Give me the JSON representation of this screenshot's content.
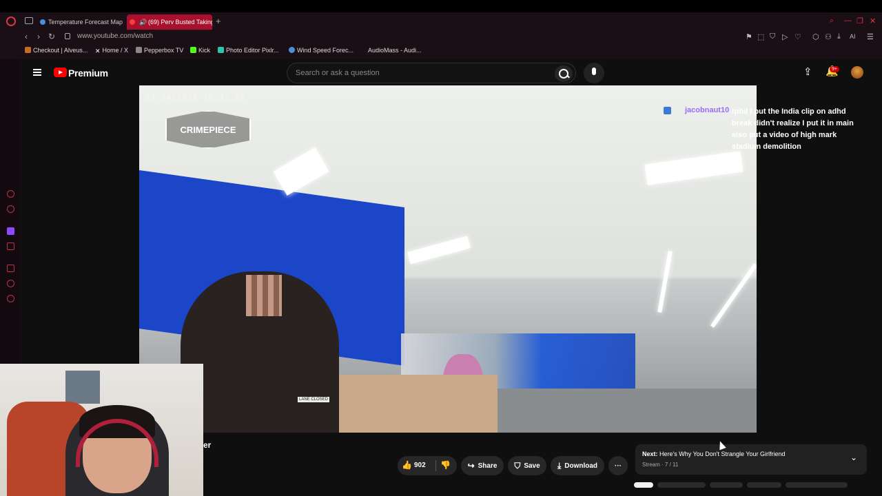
{
  "browser": {
    "tabs": [
      {
        "label": "Temperature Forecast Map",
        "active": false
      },
      {
        "label": "(69) Perv Busted Taking",
        "active": true
      }
    ],
    "new_tab": "+",
    "url": "www.youtube.com/watch",
    "bookmarks": [
      {
        "label": "Checkout | Alveus...",
        "color": "#c46b2a"
      },
      {
        "label": "Home / X",
        "color": "#ffffff"
      },
      {
        "label": "Pepperbox TV",
        "color": "#888888"
      },
      {
        "label": "Kick",
        "color": "#53fc18"
      },
      {
        "label": "Photo Editor Pixlr...",
        "color": "#2ac4a8"
      },
      {
        "label": "Wind Speed Forec...",
        "color": "#4a90d9"
      },
      {
        "label": "AudioMass - Audi...",
        "color": "#888888"
      }
    ],
    "ai_label": "AI"
  },
  "youtube": {
    "brand": "Premium",
    "search_placeholder": "Search or ask a question",
    "notif_count": "9+",
    "accent": "#ff0000"
  },
  "video": {
    "timestamp": "03/04/2025  20:32:00",
    "logo_text": "CRIMEPIECE",
    "lane_sign": "LANE CLOSED"
  },
  "chat": {
    "username": "jacobnaut10",
    "message": "!phil I put the India clip on adhd break didn't realize I put it in main also put a video of high mark stadium demolition"
  },
  "below_video": {
    "title_fragment": "er",
    "like_count": "902",
    "share_label": "Share",
    "save_label": "Save",
    "download_label": "Download",
    "more_label": "···"
  },
  "next_up": {
    "prefix": "Next:",
    "title": "Here's Why You Don't Strangle Your Girlfriend",
    "subtitle": "Stream · 7 / 11"
  }
}
